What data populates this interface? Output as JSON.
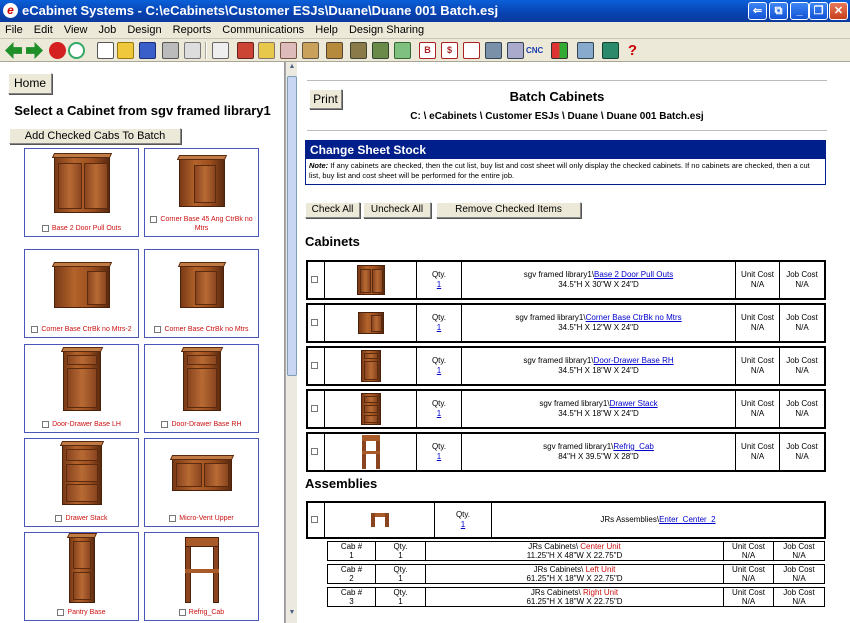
{
  "window": {
    "title": "eCabinet Systems - C:\\eCabinets\\Customer ESJs\\Duane\\Duane 001 Batch.esj",
    "app_icon": "e"
  },
  "menu": [
    "File",
    "Edit",
    "View",
    "Job",
    "Design",
    "Reports",
    "Communications",
    "Help",
    "Design Sharing"
  ],
  "left": {
    "home_label": "Home",
    "title": "Select a Cabinet from sgv framed library1",
    "add_button": "Add Checked Cabs To Batch",
    "tiles": [
      {
        "label": "Base 2 Door Pull Outs"
      },
      {
        "label": "Corner Base 45 Ang CtrBk no Mtrs"
      },
      {
        "label": "Corner Base CtrBk no Mtrs-2"
      },
      {
        "label": "Corner Base CtrBk no Mtrs"
      },
      {
        "label": "Door-Drawer Base LH"
      },
      {
        "label": "Door-Drawer Base RH"
      },
      {
        "label": "Drawer Stack"
      },
      {
        "label": "Micro-Vent Upper"
      },
      {
        "label": "Pantry Base"
      },
      {
        "label": "Refrig_Cab"
      }
    ]
  },
  "right": {
    "print_label": "Print",
    "title": "Batch Cabinets",
    "path": "C: \\ eCabinets \\ Customer ESJs \\ Duane \\ Duane 001 Batch.esj",
    "sheet_header": "Change Sheet Stock",
    "note_label": "Note:",
    "note_text": "If any cabinets are checked, then the cut list, buy list and cost sheet will only display the checked cabinets. If no cabinets are checked, then a cut list, buy list and cost sheet will be performed for the entire job.",
    "check_all": "Check All",
    "uncheck_all": "Uncheck All",
    "remove_checked": "Remove Checked Items",
    "cabinets_heading": "Cabinets",
    "assemblies_heading": "Assemblies",
    "qty_label": "Qty.",
    "unit_cost_label": "Unit Cost",
    "job_cost_label": "Job Cost",
    "na": "N/A",
    "cabinets": [
      {
        "library": "sgv framed library1\\",
        "name": "Base 2 Door Pull Outs",
        "dims": "34.5\"H X 30\"W X 24\"D",
        "qty": "1"
      },
      {
        "library": "sgv framed library1\\",
        "name": "Corner Base CtrBk no Mtrs",
        "dims": "34.5\"H X 12\"W X 24\"D",
        "qty": "1"
      },
      {
        "library": "sgv framed library1\\",
        "name": "Door-Drawer Base RH",
        "dims": "34.5\"H X 18\"W X 24\"D",
        "qty": "1"
      },
      {
        "library": "sgv framed library1\\",
        "name": "Drawer Stack",
        "dims": "34.5\"H X 18\"W X 24\"D",
        "qty": "1"
      },
      {
        "library": "sgv framed library1\\",
        "name": "Refrig_Cab",
        "dims": "84\"H X 39.5\"W X 28\"D",
        "qty": "1"
      }
    ],
    "assembly": {
      "library": "JRs Assemblies\\",
      "name": "Enter_Center_2",
      "qty": "1"
    },
    "cab_num_label": "Cab #",
    "sub_units": [
      {
        "num": "1",
        "qty": "1",
        "library": "JRs Cabinets\\ ",
        "name": "Center Unit",
        "dims": "11.25\"H X 48\"W X 22.75\"D"
      },
      {
        "num": "2",
        "qty": "1",
        "library": "JRs Cabinets\\ ",
        "name": "Left Unit",
        "dims": "61.25\"H X 18\"W X 22.75\"D"
      },
      {
        "num": "3",
        "qty": "1",
        "library": "JRs Cabinets\\ ",
        "name": "Right Unit",
        "dims": "61.25\"H X 18\"W X 22.75\"D"
      }
    ]
  },
  "colors": {
    "title_bar": "#0842b0",
    "section_header": "#001f8a",
    "caption_red": "#cc1111",
    "link_blue": "#0000cc"
  }
}
